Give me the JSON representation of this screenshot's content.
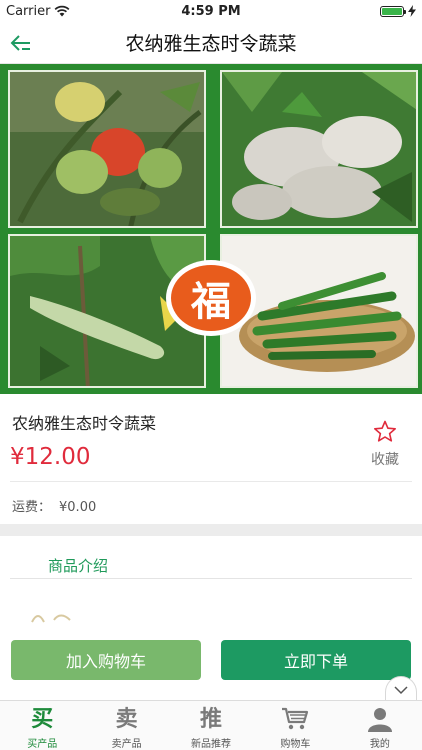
{
  "status_bar": {
    "carrier": "Carrier",
    "time": "4:59 PM"
  },
  "nav": {
    "title": "农纳雅生态时令蔬菜",
    "back_icon": "back-arrow-icon"
  },
  "hero": {
    "badge_text": "福"
  },
  "product": {
    "name": "农纳雅生态时令蔬菜",
    "price": "¥12.00",
    "favorite_label": "收藏",
    "shipping_label": "运费：",
    "shipping_value": "¥0.00"
  },
  "details": {
    "intro_tab": "商品介绍"
  },
  "actions": {
    "add_to_cart": "加入购物车",
    "buy_now": "立即下单"
  },
  "tab_bar": {
    "items": [
      {
        "glyph": "买",
        "label": "买产品",
        "active": true
      },
      {
        "glyph": "卖",
        "label": "卖产品",
        "active": false
      },
      {
        "glyph": "推",
        "label": "新品推荐",
        "active": false
      },
      {
        "glyph": "cart-icon",
        "label": "购物车",
        "active": false
      },
      {
        "glyph": "user-icon",
        "label": "我的",
        "active": false
      }
    ]
  },
  "colors": {
    "accent": "#1d9a62",
    "price": "#e02b3c",
    "cart_button": "#79b86c",
    "tab_active": "#1d8a3a"
  }
}
